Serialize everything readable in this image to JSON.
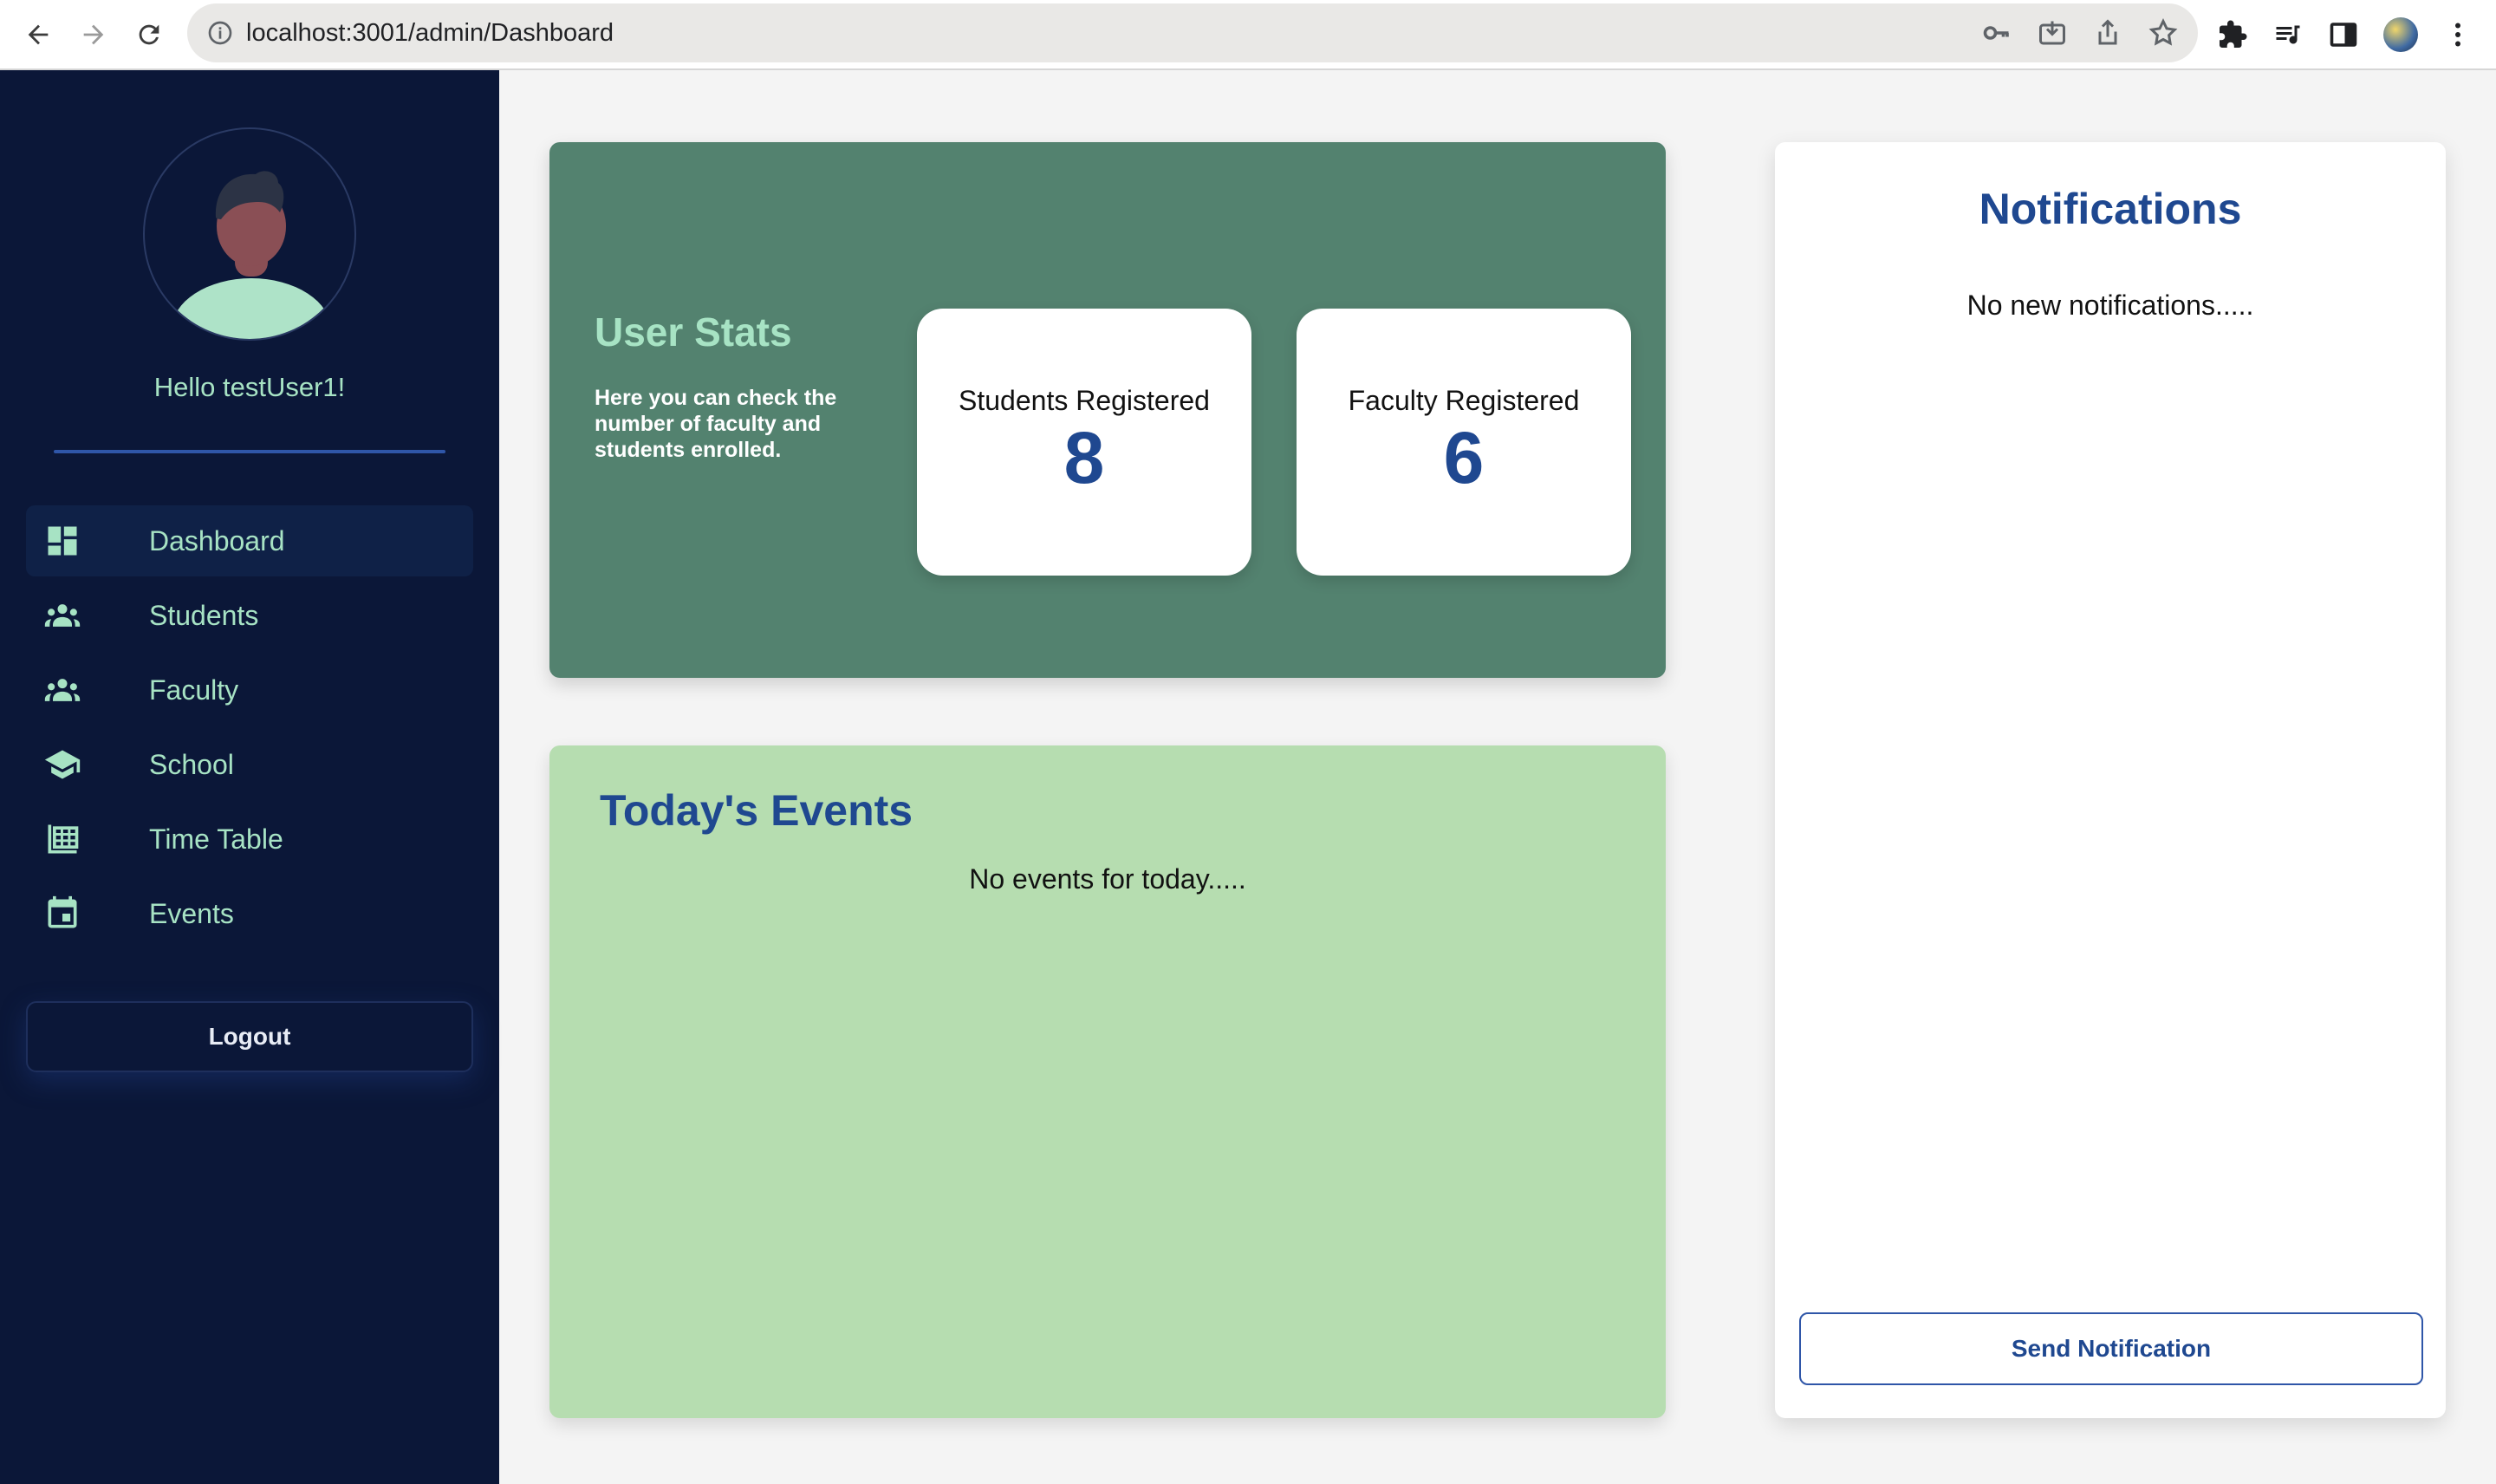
{
  "browser": {
    "url": "localhost:3001/admin/Dashboard"
  },
  "sidebar": {
    "greeting": "Hello testUser1!",
    "items": [
      {
        "label": "Dashboard",
        "icon": "dashboard-icon",
        "active": true
      },
      {
        "label": "Students",
        "icon": "people-icon",
        "active": false
      },
      {
        "label": "Faculty",
        "icon": "people-icon",
        "active": false
      },
      {
        "label": "School",
        "icon": "school-icon",
        "active": false
      },
      {
        "label": "Time Table",
        "icon": "calendar-grid-icon",
        "active": false
      },
      {
        "label": "Events",
        "icon": "event-icon",
        "active": false
      }
    ],
    "logout_label": "Logout"
  },
  "stats": {
    "title": "User Stats",
    "description": "Here you can check the number of faculty and students enrolled.",
    "students_label": "Students Registered",
    "students_value": "8",
    "faculty_label": "Faculty Registered",
    "faculty_value": "6"
  },
  "events": {
    "title": "Today's Events",
    "empty_text": "No events for today....."
  },
  "notifications": {
    "title": "Notifications",
    "empty_text": "No new notifications.....",
    "send_label": "Send Notification"
  },
  "colors": {
    "sidebar_bg": "#0b1738",
    "accent_text": "#a7e3c4",
    "stats_bg": "#53826f",
    "events_bg": "#b6ddb0",
    "primary_blue": "#1f4890"
  }
}
